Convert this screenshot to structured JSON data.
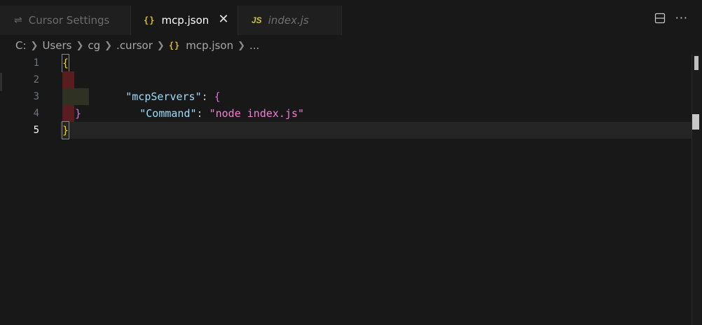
{
  "tabs": [
    {
      "label": "Cursor Settings",
      "icon": "settings-sliders-icon",
      "active": false
    },
    {
      "label": "mcp.json",
      "icon": "json-braces-icon",
      "active": true
    },
    {
      "label": "index.js",
      "icon": "js-file-icon",
      "active": false
    }
  ],
  "tab_icons": {
    "json": "{}",
    "js": "JS",
    "settings": "⇌"
  },
  "breadcrumb": {
    "parts": [
      "C:",
      "Users",
      "cg",
      ".cursor"
    ],
    "file": "mcp.json",
    "file_icon": "{}",
    "trailing": "..."
  },
  "editor": {
    "lines": [
      {
        "number": "1"
      },
      {
        "number": "2",
        "key": "\"mcpServers\"",
        "punct": ": ",
        "brace": "{"
      },
      {
        "number": "3",
        "key": "\"Command\"",
        "punct": ": ",
        "value": "\"node index.js\""
      },
      {
        "number": "4",
        "brace": "}"
      },
      {
        "number": "5",
        "brace": "}"
      }
    ],
    "line1_brace": "{",
    "active_line": "5"
  },
  "colors": {
    "background": "#181818",
    "key": "#9cdcfe",
    "string": "#f17fd6",
    "brace_outer": "#f1d700",
    "brace_inner": "#da70d6"
  }
}
